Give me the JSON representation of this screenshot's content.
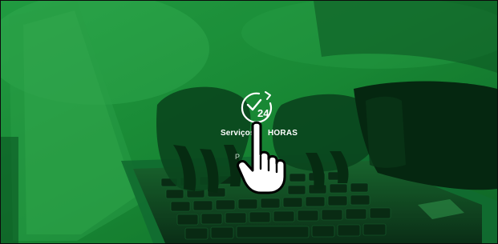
{
  "banner": {
    "badge_number": "24",
    "label_left": "Serviços",
    "label_right": "HORAS",
    "sub_label": "P"
  },
  "icons": {
    "clock": "clock-check-24-icon",
    "cursor": "hand-pointer-icon"
  },
  "colors": {
    "overlay_green": "#1f9a3e",
    "dark_green": "#0c3a1a",
    "white": "#ffffff"
  }
}
